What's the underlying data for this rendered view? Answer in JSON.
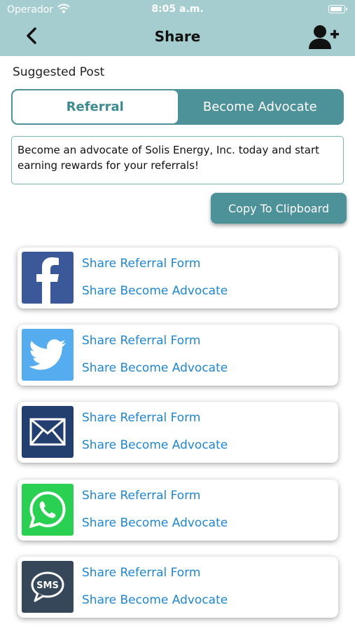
{
  "status_bar": {
    "carrier": "Operador",
    "time": "8:05 a.m.",
    "battery_level": 0.9
  },
  "header": {
    "title": "Share"
  },
  "suggested_post": {
    "heading": "Suggested Post",
    "tabs": [
      {
        "label": "Referral",
        "selected": true
      },
      {
        "label": "Become Advocate",
        "selected": false
      }
    ],
    "text": "Become an advocate of Solis Energy, Inc. today and start earning rewards for your referrals!",
    "copy_label": "Copy To Clipboard"
  },
  "share_options": [
    {
      "icon": "facebook-icon",
      "color": "#3b5998",
      "link_referral": "Share Referral Form",
      "link_advocate": "Share Become Advocate"
    },
    {
      "icon": "twitter-icon",
      "color": "#55acee",
      "link_referral": "Share Referral Form",
      "link_advocate": "Share Become Advocate"
    },
    {
      "icon": "email-icon",
      "color": "#233f6f",
      "link_referral": "Share Referral Form",
      "link_advocate": "Share Become Advocate"
    },
    {
      "icon": "whatsapp-icon",
      "color": "#2ad052",
      "link_referral": "Share Referral Form",
      "link_advocate": "Share Become Advocate"
    },
    {
      "icon": "sms-icon",
      "color": "#36475a",
      "link_referral": "Share Referral Form",
      "link_advocate": "Share Become Advocate"
    }
  ],
  "colors": {
    "header_bg": "#a5cccf",
    "accent": "#4d9199",
    "link": "#1f86d1"
  }
}
